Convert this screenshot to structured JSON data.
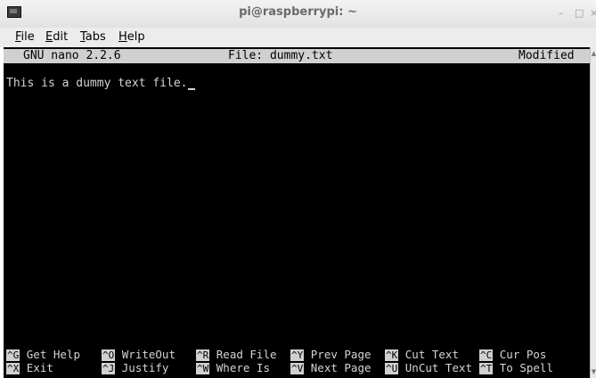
{
  "window": {
    "title": "pi@raspberrypi: ~",
    "minimize": "–",
    "maximize": "□",
    "close": "×"
  },
  "menubar": [
    {
      "underline": "F",
      "rest": "ile"
    },
    {
      "underline": "E",
      "rest": "dit"
    },
    {
      "underline": "T",
      "rest": "abs"
    },
    {
      "underline": "H",
      "rest": "elp"
    }
  ],
  "nano": {
    "version": "GNU nano 2.2.6",
    "file": "File: dummy.txt",
    "status": "Modified"
  },
  "content": {
    "line1": "This is a dummy text file."
  },
  "shortcuts": {
    "row1": [
      {
        "key": "^G",
        "label": "Get Help"
      },
      {
        "key": "^O",
        "label": "WriteOut"
      },
      {
        "key": "^R",
        "label": "Read File"
      },
      {
        "key": "^Y",
        "label": "Prev Page"
      },
      {
        "key": "^K",
        "label": "Cut Text"
      },
      {
        "key": "^C",
        "label": "Cur Pos"
      }
    ],
    "row2": [
      {
        "key": "^X",
        "label": "Exit"
      },
      {
        "key": "^J",
        "label": "Justify"
      },
      {
        "key": "^W",
        "label": "Where Is"
      },
      {
        "key": "^V",
        "label": "Next Page"
      },
      {
        "key": "^U",
        "label": "UnCut Text"
      },
      {
        "key": "^T",
        "label": "To Spell"
      }
    ]
  },
  "scrollbar": {
    "up": "▲",
    "down": "▼"
  }
}
